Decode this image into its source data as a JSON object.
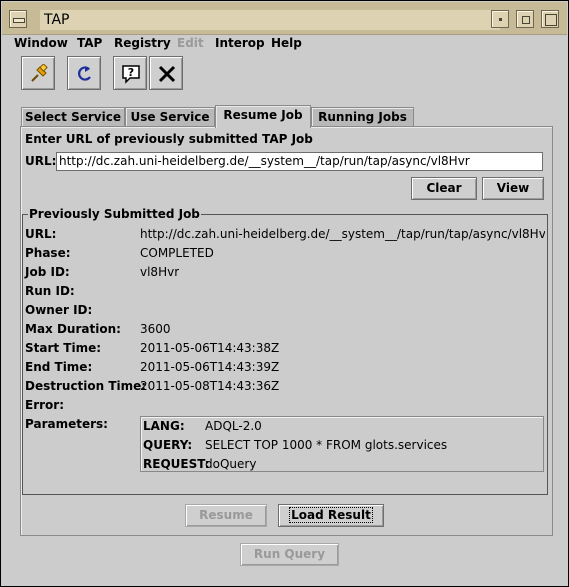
{
  "window": {
    "title": "TAP"
  },
  "menu": [
    {
      "label": "Window",
      "disabled": false
    },
    {
      "label": "TAP",
      "disabled": false
    },
    {
      "label": "Registry",
      "disabled": false
    },
    {
      "label": "Edit",
      "disabled": true
    },
    {
      "label": "Interop",
      "disabled": false
    },
    {
      "label": "Help",
      "disabled": false
    }
  ],
  "toolbar": {
    "icons": [
      "pin-icon",
      "reload-icon",
      "help-icon",
      "close-icon"
    ]
  },
  "tabs": [
    {
      "label": "Select Service",
      "active": false
    },
    {
      "label": "Use Service",
      "active": false
    },
    {
      "label": "Resume Job",
      "active": true
    },
    {
      "label": "Running Jobs",
      "active": false
    }
  ],
  "resume": {
    "prompt": "Enter URL of previously submitted TAP Job",
    "url_label": "URL:",
    "url_value": "http://dc.zah.uni-heidelberg.de/__system__/tap/run/tap/async/vl8Hvr",
    "clear_label": "Clear",
    "view_label": "View"
  },
  "job": {
    "group_title": "Previously Submitted Job",
    "fields": [
      {
        "label": "URL:",
        "value": "http://dc.zah.uni-heidelberg.de/__system__/tap/run/tap/async/vl8Hv"
      },
      {
        "label": "Phase:",
        "value": "COMPLETED"
      },
      {
        "label": "Job ID:",
        "value": "vl8Hvr"
      },
      {
        "label": "Run ID:",
        "value": ""
      },
      {
        "label": "Owner ID:",
        "value": ""
      },
      {
        "label": "Max Duration:",
        "value": "3600"
      },
      {
        "label": "Start Time:",
        "value": "2011-05-06T14:43:38Z"
      },
      {
        "label": "End Time:",
        "value": "2011-05-06T14:43:39Z"
      },
      {
        "label": "Destruction Time:",
        "value": "2011-05-08T14:43:36Z"
      },
      {
        "label": "Error:",
        "value": ""
      }
    ],
    "parameters_label": "Parameters:",
    "parameters": [
      {
        "key": "LANG:",
        "value": "ADQL-2.0"
      },
      {
        "key": "QUERY:",
        "value": "SELECT TOP 1000 * FROM glots.services"
      },
      {
        "key": "REQUEST:",
        "value": "doQuery"
      }
    ]
  },
  "actions": {
    "resume_label": "Resume",
    "load_label": "Load Result",
    "run_query_label": "Run Query"
  },
  "colors": {
    "titlebar": "#c6ba97",
    "window_bg": "#cccccc"
  }
}
